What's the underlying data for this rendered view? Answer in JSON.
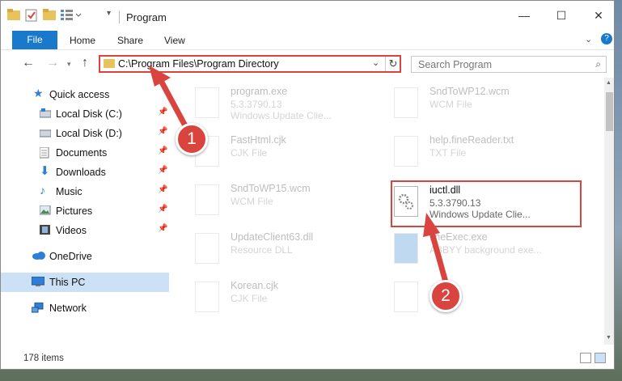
{
  "window": {
    "title": "Program",
    "controls": {
      "minimize": "—",
      "maximize": "☐",
      "close": "✕"
    }
  },
  "ribbon": {
    "file_tab": "File",
    "tabs": [
      "Home",
      "Share",
      "View"
    ]
  },
  "nav": {
    "address": "C:\\Program Files\\Program Directory",
    "search_placeholder": "Search Program"
  },
  "sidebar": {
    "items": [
      {
        "label": "Quick access",
        "icon": "star-icon"
      },
      {
        "label": "Local Disk (C:)",
        "icon": "drive-icon",
        "pinned": true
      },
      {
        "label": "Local Disk (D:)",
        "icon": "drive-icon",
        "pinned": true
      },
      {
        "label": "Documents",
        "icon": "documents-icon",
        "pinned": true
      },
      {
        "label": "Downloads",
        "icon": "download-icon",
        "pinned": true
      },
      {
        "label": "Music",
        "icon": "music-icon",
        "pinned": true
      },
      {
        "label": "Pictures",
        "icon": "pictures-icon",
        "pinned": true
      },
      {
        "label": "Videos",
        "icon": "videos-icon",
        "pinned": true
      },
      {
        "label": "OneDrive",
        "icon": "cloud-icon"
      },
      {
        "label": "This PC",
        "icon": "computer-icon",
        "selected": true
      },
      {
        "label": "Network",
        "icon": "network-icon"
      }
    ]
  },
  "files": [
    {
      "name": "program.exe",
      "line1": "5.3.3790.13",
      "line2": "Windows Update Clie..."
    },
    {
      "name": "SndToWP12.wcm",
      "line1": "WCM File",
      "line2": ""
    },
    {
      "name": "FastHtml.cjk",
      "line1": "CJK File",
      "line2": ""
    },
    {
      "name": "help.fineReader.txt",
      "line1": "TXT File",
      "line2": ""
    },
    {
      "name": "SndToWP15.wcm",
      "line1": "WCM File",
      "line2": ""
    },
    {
      "name": "iuctl.dll",
      "line1": "5.3.3790.13",
      "line2": "Windows Update Clie..."
    },
    {
      "name": "UpdateClient63.dll",
      "line1": "Resource DLL",
      "line2": ""
    },
    {
      "name": "fineExec.exe",
      "line1": "ABBYY background exe...",
      "line2": ""
    },
    {
      "name": "Korean.cjk",
      "line1": "CJK File",
      "line2": ""
    },
    {
      "name": "",
      "line1": "",
      "line2": ""
    }
  ],
  "status": {
    "item_count": "178 items"
  },
  "callouts": {
    "one": "1",
    "two": "2"
  },
  "colors": {
    "accent": "#1979ca",
    "highlight": "#d9443f",
    "selected": "#cce1f5"
  }
}
